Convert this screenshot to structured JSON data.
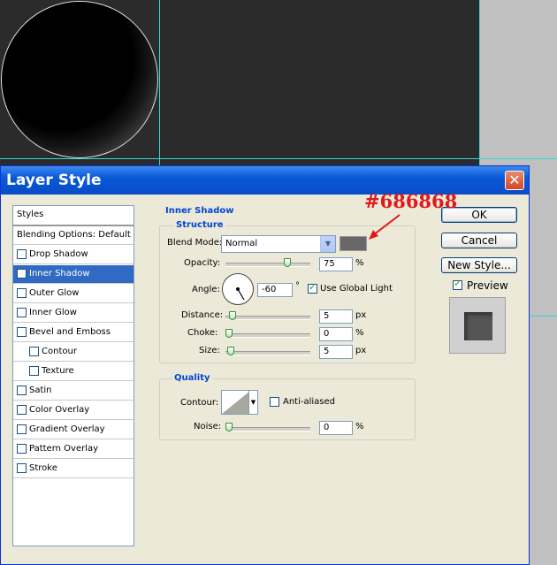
{
  "window": {
    "title": "Layer Style",
    "close_glyph": "✕"
  },
  "styles_list": {
    "header": "Styles",
    "items": [
      {
        "label": "Blending Options: Default",
        "checkbox": false,
        "checked": false,
        "selected": false,
        "sub": false
      },
      {
        "label": "Drop Shadow",
        "checkbox": true,
        "checked": false,
        "selected": false,
        "sub": false
      },
      {
        "label": "Inner Shadow",
        "checkbox": true,
        "checked": true,
        "selected": true,
        "sub": false
      },
      {
        "label": "Outer Glow",
        "checkbox": true,
        "checked": false,
        "selected": false,
        "sub": false
      },
      {
        "label": "Inner Glow",
        "checkbox": true,
        "checked": false,
        "selected": false,
        "sub": false
      },
      {
        "label": "Bevel and Emboss",
        "checkbox": true,
        "checked": false,
        "selected": false,
        "sub": false
      },
      {
        "label": "Contour",
        "checkbox": true,
        "checked": false,
        "selected": false,
        "sub": true
      },
      {
        "label": "Texture",
        "checkbox": true,
        "checked": false,
        "selected": false,
        "sub": true
      },
      {
        "label": "Satin",
        "checkbox": true,
        "checked": false,
        "selected": false,
        "sub": false
      },
      {
        "label": "Color Overlay",
        "checkbox": true,
        "checked": false,
        "selected": false,
        "sub": false
      },
      {
        "label": "Gradient Overlay",
        "checkbox": true,
        "checked": false,
        "selected": false,
        "sub": false
      },
      {
        "label": "Pattern Overlay",
        "checkbox": true,
        "checked": false,
        "selected": false,
        "sub": false
      },
      {
        "label": "Stroke",
        "checkbox": true,
        "checked": false,
        "selected": false,
        "sub": false
      }
    ]
  },
  "inner_shadow": {
    "title": "Inner Shadow",
    "structure_title": "Structure",
    "blend_mode": {
      "label": "Blend Mode:",
      "value": "Normal"
    },
    "shadow_color": "#686868",
    "opacity": {
      "label": "Opacity:",
      "value": "75",
      "unit": "%",
      "level": 0.75
    },
    "angle": {
      "label": "Angle:",
      "value": "-60",
      "unit": "°",
      "use_global_light": "Use Global Light",
      "use_global_light_checked": true
    },
    "distance": {
      "label": "Distance:",
      "value": "5",
      "unit": "px",
      "level": 0.04
    },
    "choke": {
      "label": "Choke:",
      "value": "0",
      "unit": "%",
      "level": 0.0
    },
    "size": {
      "label": "Size:",
      "value": "5",
      "unit": "px",
      "level": 0.02
    },
    "quality_title": "Quality",
    "contour": {
      "label": "Contour:",
      "anti_aliased": "Anti-aliased",
      "anti_aliased_checked": false
    },
    "noise": {
      "label": "Noise:",
      "value": "0",
      "unit": "%",
      "level": 0.0
    }
  },
  "buttons": {
    "ok": "OK",
    "cancel": "Cancel",
    "new_style": "New Style..."
  },
  "preview": {
    "label": "Preview",
    "checked": true
  },
  "annotation": {
    "text": "#686868",
    "color": "#e01a1a"
  },
  "colors": {
    "accent": "#0a58d6",
    "selection": "#316ac5",
    "group_title": "#0046d5"
  }
}
